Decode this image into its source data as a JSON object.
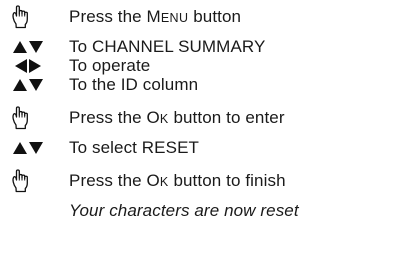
{
  "steps": [
    {
      "icon": "hand-press-icon",
      "pre": "Press the ",
      "key_first": "M",
      "key_rest": "ENU",
      "post": " button"
    },
    {
      "icon": "up-down-arrows-icon",
      "text": "To CHANNEL SUMMARY"
    },
    {
      "icon": "left-right-arrows-icon",
      "text": "To operate"
    },
    {
      "icon": "up-down-arrows-icon",
      "text": "To the ID column"
    },
    {
      "icon": "hand-press-icon",
      "pre": "Press the ",
      "key_first": "O",
      "key_rest": "K",
      "post": " button to enter"
    },
    {
      "icon": "up-down-arrows-icon",
      "text": "To select RESET"
    },
    {
      "icon": "hand-press-icon",
      "pre": "Press the ",
      "key_first": "O",
      "key_rest": "K",
      "post": " button to finish"
    },
    {
      "icon": "",
      "text": "Your characters are now reset"
    }
  ]
}
